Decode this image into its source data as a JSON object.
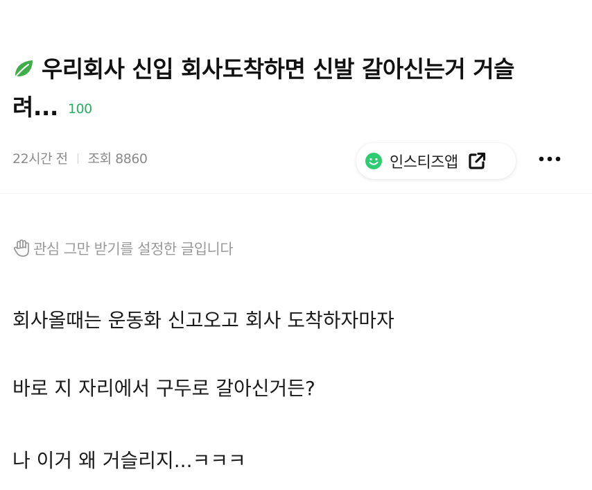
{
  "post": {
    "title": "우리회사 신입 회사도착하면 신발 갈아신는거 거슬려...",
    "comment_count": "100",
    "time_ago": "22시간 전",
    "views": "조회 8860"
  },
  "app_button": {
    "label": "인스티즈앱",
    "icon": "smile-icon",
    "accent": "#2ecc71"
  },
  "more_icon": "more-icon",
  "notice": {
    "icon": "hand-icon",
    "text": "관심 그만 받기를 설정한 글입니다"
  },
  "content": {
    "lines": [
      "회사올때는 운동화 신고오고 회사 도착하자마자",
      "바로 지 자리에서 구두로 갈아신거든?",
      "나 이거 왜 거슬리지...ㅋㅋㅋ"
    ]
  },
  "colors": {
    "count_green": "#27ae60",
    "meta_gray": "#8a8a8a",
    "leaf_green": "#3fae4a"
  }
}
